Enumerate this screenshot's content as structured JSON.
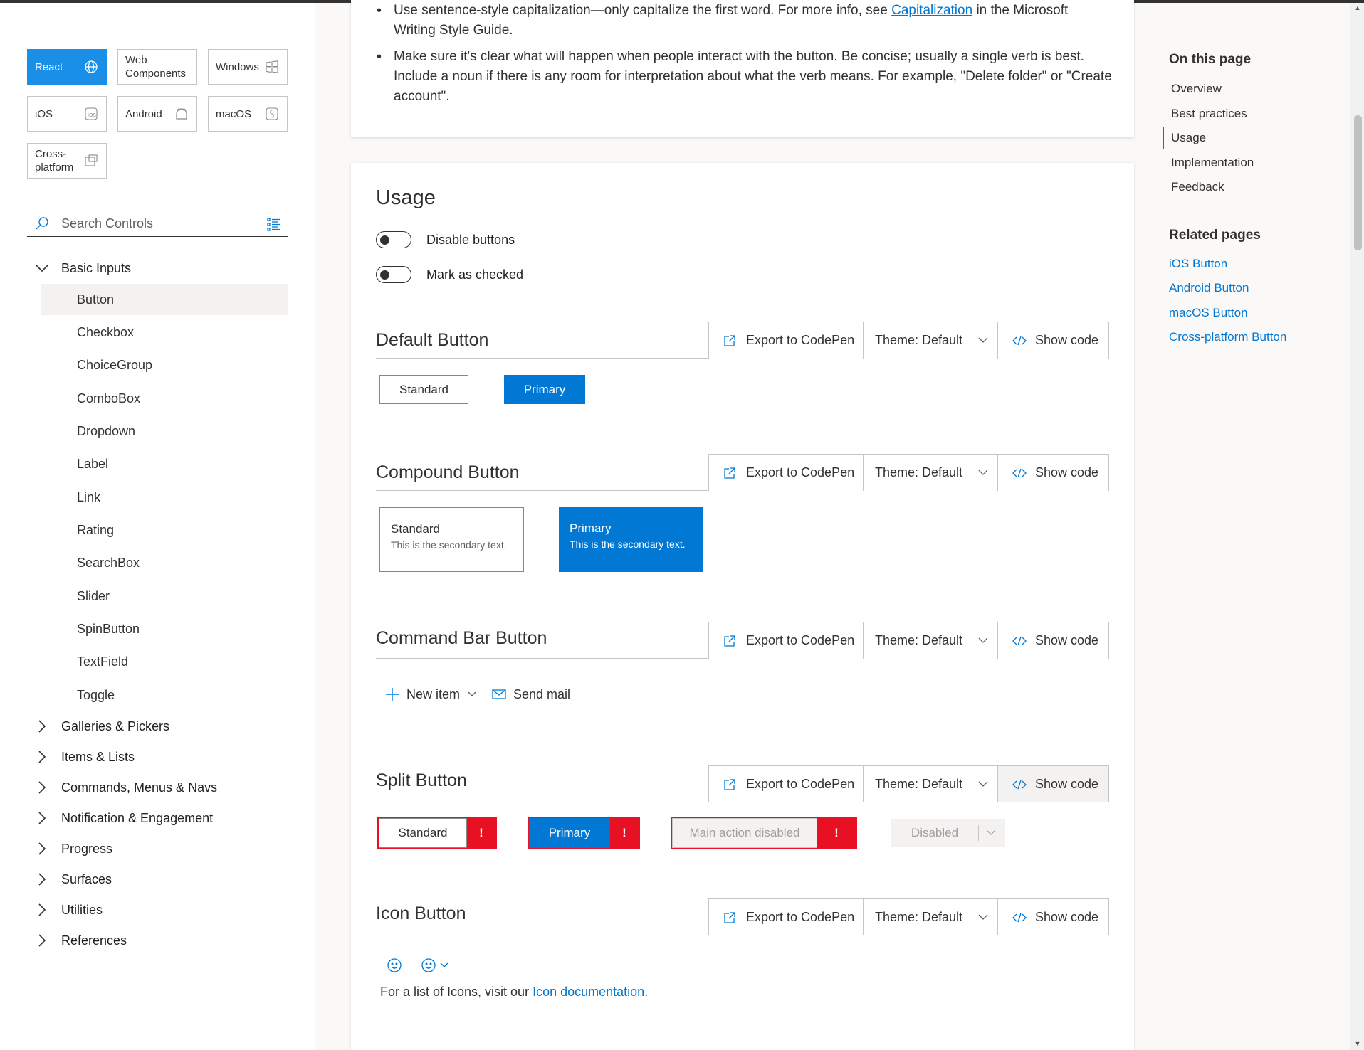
{
  "platforms": [
    {
      "label": "React",
      "icon": "globe-icon"
    },
    {
      "label": "Web Components",
      "icon": ""
    },
    {
      "label": "Windows",
      "icon": "windows-icon"
    },
    {
      "label": "iOS",
      "icon": "ios-icon"
    },
    {
      "label": "Android",
      "icon": "android-icon"
    },
    {
      "label": "macOS",
      "icon": "macos-icon"
    },
    {
      "label": "Cross-platform",
      "icon": "cross-platform-icon"
    }
  ],
  "search": {
    "placeholder": "Search Controls"
  },
  "nav": {
    "basic_inputs": "Basic Inputs",
    "items": [
      "Button",
      "Checkbox",
      "ChoiceGroup",
      "ComboBox",
      "Dropdown",
      "Label",
      "Link",
      "Rating",
      "SearchBox",
      "Slider",
      "SpinButton",
      "TextField",
      "Toggle"
    ],
    "groups": [
      "Galleries & Pickers",
      "Items & Lists",
      "Commands, Menus & Navs",
      "Notification & Engagement",
      "Progress",
      "Surfaces",
      "Utilities",
      "References"
    ]
  },
  "content": {
    "bullet1_pre": "Use sentence-style capitalization—only capitalize the first word. For more info, see ",
    "bullet1_link": "Capitalization",
    "bullet1_post": " in the Microsoft Writing Style Guide.",
    "bullet2": "Make sure it's clear what will happen when people interact with the button. Be concise; usually a single verb is best. Include a noun if there is any room for interpretation about what the verb means. For example, \"Delete folder\" or \"Create account\"."
  },
  "usage": {
    "title": "Usage",
    "toggle1": "Disable buttons",
    "toggle2": "Mark as checked"
  },
  "toolbar": {
    "export": "Export to CodePen",
    "theme": "Theme: Default",
    "code": "Show code"
  },
  "sections": {
    "default": {
      "title": "Default Button",
      "standard": "Standard",
      "primary": "Primary"
    },
    "compound": {
      "title": "Compound Button",
      "standard": "Standard",
      "primary": "Primary",
      "secondary": "This is the secondary text."
    },
    "commandbar": {
      "title": "Command Bar Button",
      "new_item": "New item",
      "send_mail": "Send mail"
    },
    "split": {
      "title": "Split Button",
      "standard": "Standard",
      "primary": "Primary",
      "main_disabled": "Main action disabled",
      "disabled": "Disabled",
      "error_mark": "!"
    },
    "icon": {
      "title": "Icon Button",
      "note_pre": "For a list of Icons, visit our ",
      "note_link": "Icon documentation",
      "note_post": "."
    }
  },
  "rail": {
    "on_this_page": "On this page",
    "toc": [
      "Overview",
      "Best practices",
      "Usage",
      "Implementation",
      "Feedback"
    ],
    "related_title": "Related pages",
    "related": [
      "iOS Button",
      "Android Button",
      "macOS Button",
      "Cross-platform Button"
    ]
  },
  "colors": {
    "accent": "#0078d4",
    "error": "#e81123",
    "active_platform": "#1a8fe8"
  }
}
